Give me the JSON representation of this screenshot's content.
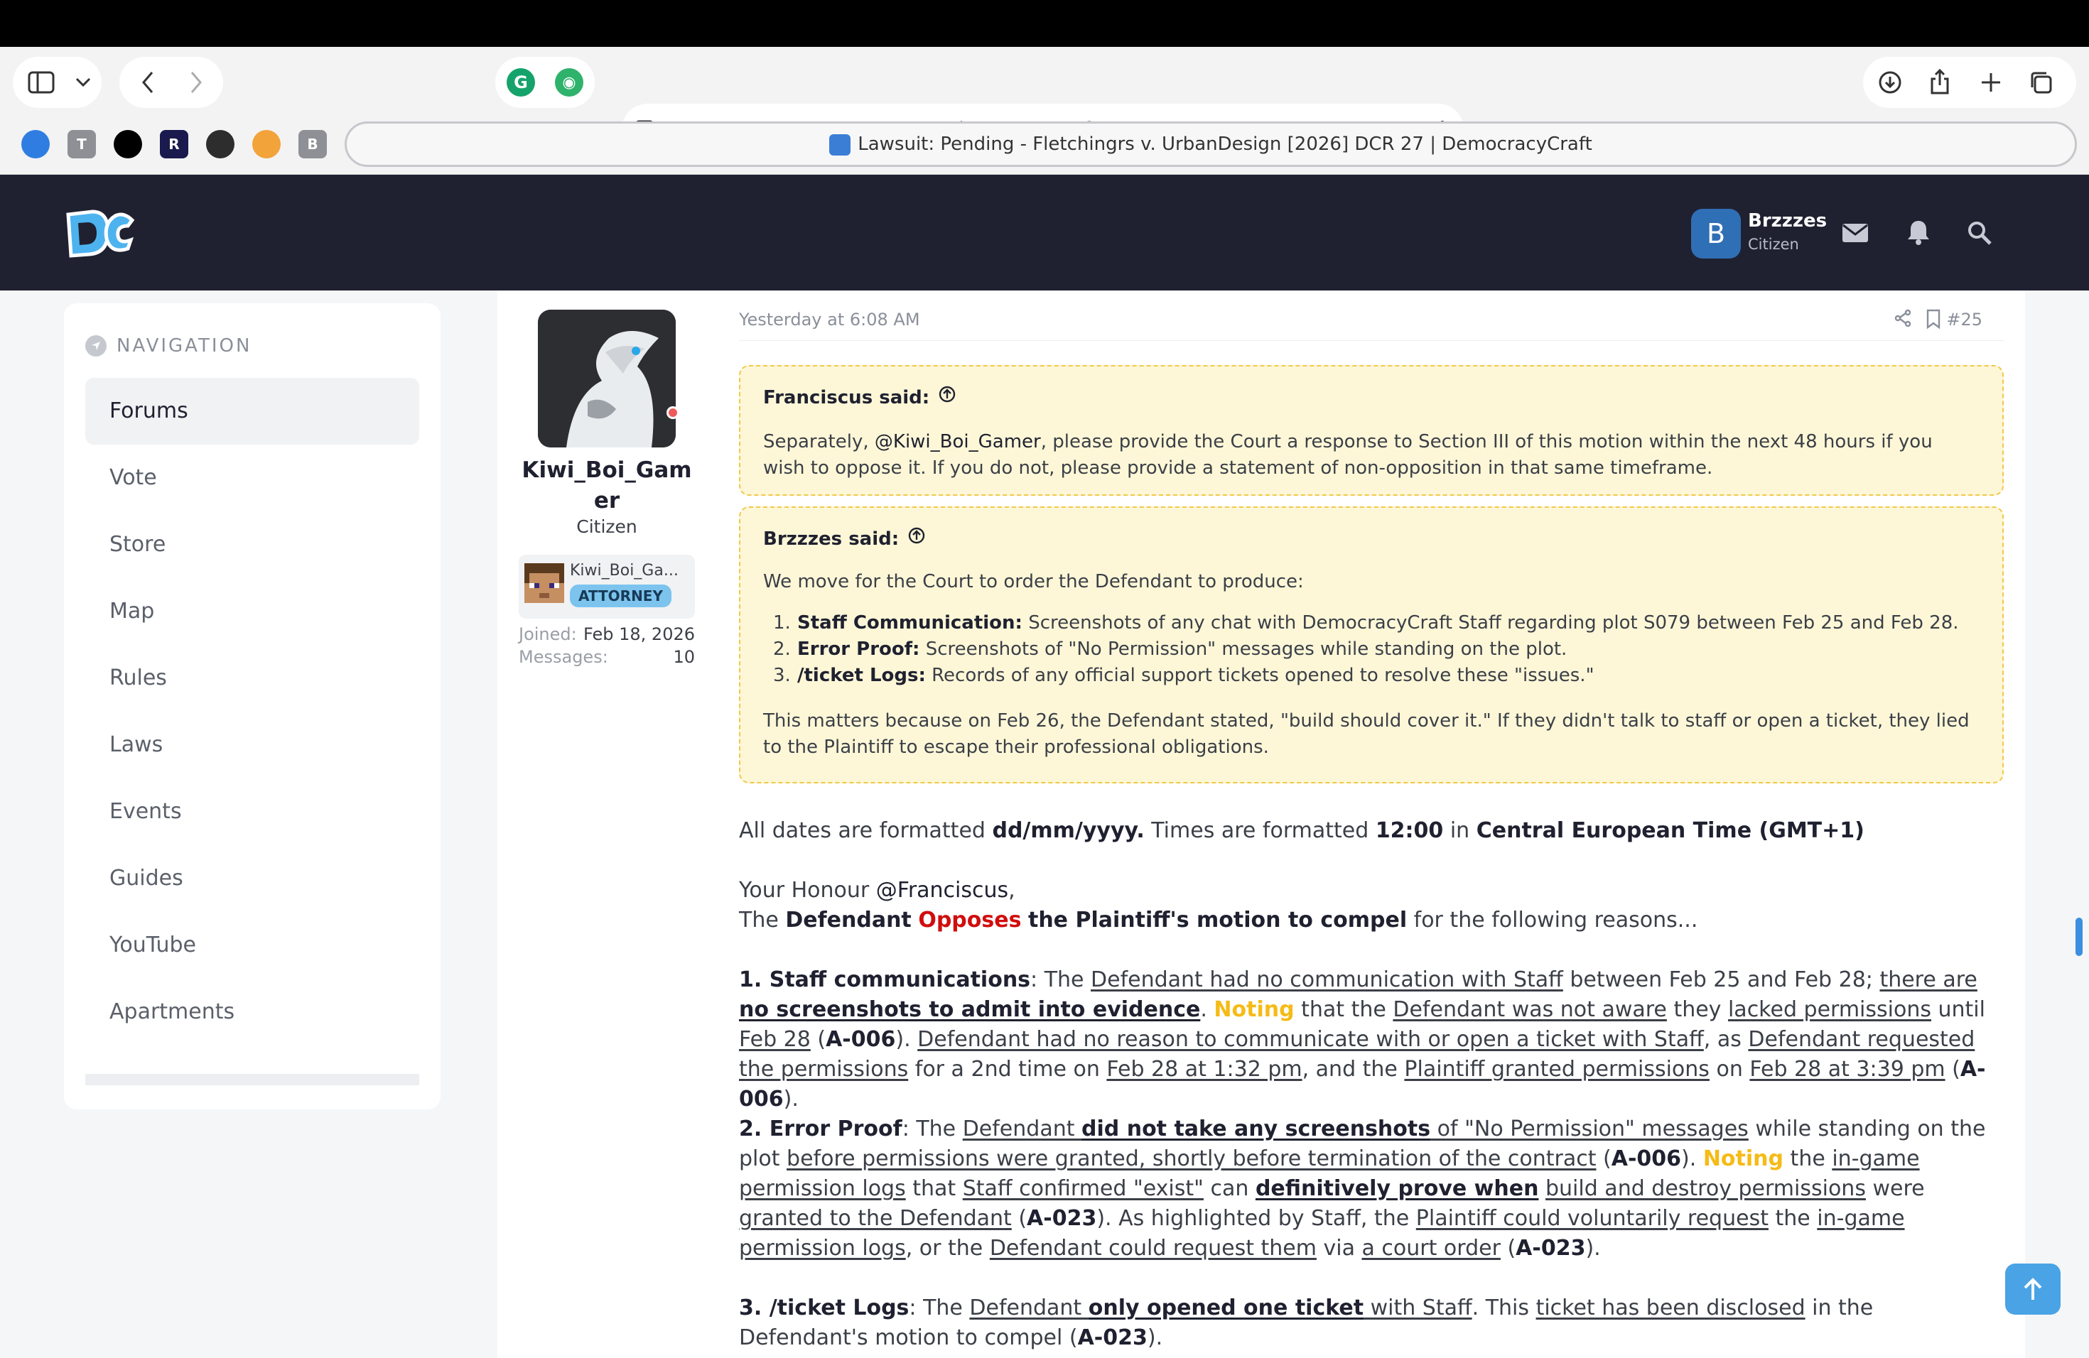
{
  "browser": {
    "url": "democracycraft.net",
    "tab_title": "Lawsuit: Pending - Fletchingrs v. UrbanDesign [2026] DCR 27 | DemocracyCraft",
    "favorites": [
      {
        "icon": "blue-circle-icon",
        "color": "#2f7de1"
      },
      {
        "icon": "t-square-icon",
        "letter": "T",
        "color": "#8e9096"
      },
      {
        "icon": "triangle-app-icon",
        "color": "#000000"
      },
      {
        "icon": "r-book-icon",
        "letter": "R",
        "color": "#1a1a4e"
      },
      {
        "icon": "dark-circle-icon",
        "color": "#2d2d2d"
      },
      {
        "icon": "sparkle-icon",
        "color": "#f2a33a"
      },
      {
        "icon": "b-square-icon",
        "letter": "B",
        "color": "#8e9096"
      }
    ]
  },
  "header": {
    "user_initial": "B",
    "user_name": "Brzzzes",
    "user_role": "Citizen"
  },
  "sidebar": {
    "heading": "NAVIGATION",
    "items": [
      {
        "label": "Forums"
      },
      {
        "label": "Vote"
      },
      {
        "label": "Store"
      },
      {
        "label": "Map"
      },
      {
        "label": "Rules"
      },
      {
        "label": "Laws"
      },
      {
        "label": "Events"
      },
      {
        "label": "Guides"
      },
      {
        "label": "YouTube"
      },
      {
        "label": "Apartments"
      }
    ]
  },
  "poster": {
    "name": "Kiwi_Boi_Gamer",
    "name_line1": "Kiwi_Boi_Gam",
    "name_line2": "er",
    "role": "Citizen",
    "mc_name": "Kiwi_Boi_Ga...",
    "badge": "ATTORNEY",
    "joined_label": "Joined:",
    "joined_value": "Feb 18, 2026",
    "messages_label": "Messages:",
    "messages_value": "10"
  },
  "post": {
    "time": "Yesterday at 6:08 AM",
    "number": "#25",
    "quote1": {
      "author": "Franciscus said:",
      "text_before": "Separately, ",
      "mention": "@Kiwi_Boi_Gamer",
      "text_after": ", please provide the Court a response to Section III of this motion within the next 48 hours if you wish to oppose it. If you do not, please provide a statement of non-opposition in that same timeframe."
    },
    "quote2": {
      "author": "Brzzzes said:",
      "intro": "We move for the Court to order the Defendant to produce:",
      "list": [
        {
          "num": "1.",
          "head": "Staff Communication:",
          "text": " Screenshots of any chat with DemocracyCraft Staff regarding plot S079 between Feb 25 and Feb 28."
        },
        {
          "num": "2.",
          "head": "Error Proof:",
          "text": " Screenshots of \"No Permission\" messages while standing on the plot."
        },
        {
          "num": "3.",
          "head": "/ticket Logs:",
          "text": " Records of any official support tickets opened to resolve these \"issues.\""
        }
      ],
      "outro": "This matters because on Feb 26, the Defendant stated, \"build should cover it.\" If they didn't talk to staff or open a ticket, they lied to the Plaintiff to escape their professional obligations."
    },
    "body": {
      "p1": [
        "All dates are formatted ",
        "dd/mm/yyyy.",
        " Times are formatted ",
        "12:00",
        " in ",
        "Central European Time (GMT+1)"
      ],
      "p2_line1": [
        "Your Honour ",
        "@Franciscus",
        ","
      ],
      "p2_line2": [
        "The ",
        "Defendant",
        " ",
        "Opposes",
        " ",
        "the Plaintiff's motion to compel",
        " for the following reasons..."
      ],
      "p3": [
        "1. Staff communications",
        ": The ",
        "Defendant had no communication with Staff",
        " between Feb 25 and Feb 28; ",
        "there are ",
        "no screenshots to admit into evidence",
        ". ",
        "Noting",
        " that the ",
        "Defendant was not aware",
        " they ",
        "lacked permissions",
        " until ",
        "Feb 28",
        " (",
        "A-006",
        "). ",
        "Defendant had no reason to communicate with or open a ticket with Staff",
        ", as ",
        "Defendant requested the permissions",
        " for a 2nd time on ",
        "Feb 28 at 1:32 pm",
        ", and the ",
        "Plaintiff granted permissions",
        " on ",
        "Feb 28 at 3:39 pm",
        " (",
        "A-006",
        ")."
      ],
      "p4": [
        "2. Error Proof",
        ": The ",
        "Defendant ",
        "did not take any screenshots",
        " of \"No Permission\" messages",
        " while standing on the plot ",
        "before permissions were granted, shortly before termination of the contract",
        " (",
        "A-006",
        "). ",
        "Noting",
        " the ",
        "in-game permission logs",
        " that ",
        "Staff confirmed \"exist\"",
        " can ",
        "definitively prove when",
        " ",
        "build and destroy permissions",
        " were ",
        "granted to the Defendant",
        " (",
        "A-023",
        "). As highlighted by Staff, the ",
        "Plaintiff could voluntarily request",
        " the ",
        "in-game permission logs",
        ", or the ",
        "Defendant could request them",
        " via ",
        "a court order",
        " (",
        "A-023",
        ")."
      ],
      "p5": [
        "3. /ticket Logs",
        ": The ",
        "Defendant ",
        "only opened one ticket",
        " with Staff",
        ". This ",
        "ticket has been disclosed",
        " in the Defendant's motion to compel (",
        "A-023",
        ")."
      ]
    }
  }
}
